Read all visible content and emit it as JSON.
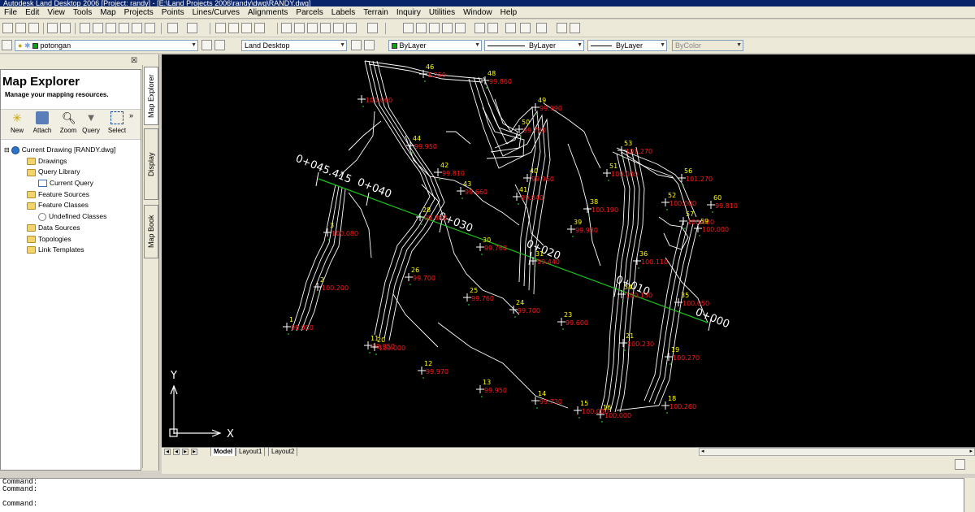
{
  "window": {
    "title": "Autodesk Land Desktop 2006 [Project: randy] - [E:\\Land Projects 2006\\randy\\dwg\\RANDY.dwg]"
  },
  "menu": [
    "File",
    "Edit",
    "View",
    "Tools",
    "Map",
    "Projects",
    "Points",
    "Lines/Curves",
    "Alignments",
    "Parcels",
    "Labels",
    "Terrain",
    "Inquiry",
    "Utilities",
    "Window",
    "Help"
  ],
  "layer_toolbar": {
    "layer_name": "potongan",
    "workspace": "Land Desktop",
    "color": "ByLayer",
    "linetype": "ByLayer",
    "lineweight": "ByLayer",
    "plotstyle": "ByColor"
  },
  "map_explorer": {
    "title": "Map Explorer",
    "subtitle": "Manage your mapping resources.",
    "tools": [
      "New",
      "Attach",
      "Zoom",
      "Query",
      "Select"
    ],
    "tree": [
      {
        "label": "Current Drawing [RANDY.dwg]",
        "level": 0,
        "icon": "globe-icon"
      },
      {
        "label": "Drawings",
        "level": 1,
        "icon": "folder-icon"
      },
      {
        "label": "Query Library",
        "level": 1,
        "icon": "folder-icon"
      },
      {
        "label": "Current Query",
        "level": 2,
        "icon": "query-icon"
      },
      {
        "label": "Feature Sources",
        "level": 1,
        "icon": "folder-icon"
      },
      {
        "label": "Feature Classes",
        "level": 1,
        "icon": "folder-icon"
      },
      {
        "label": "Undefined Classes",
        "level": 2,
        "icon": "question-icon"
      },
      {
        "label": "Data Sources",
        "level": 1,
        "icon": "folder-icon"
      },
      {
        "label": "Topologies",
        "level": 1,
        "icon": "folder-icon"
      },
      {
        "label": "Link Templates",
        "level": 1,
        "icon": "folder-icon"
      }
    ],
    "side_tabs": [
      "Map Explorer",
      "Display",
      "Map Book"
    ]
  },
  "drawing": {
    "ucs_x": "X",
    "ucs_y": "Y",
    "stations": [
      "0+045.415",
      "0+040",
      "0+030",
      "0+020",
      "0+010",
      "0+000"
    ],
    "points": [
      {
        "n": "46",
        "e": "1.250"
      },
      {
        "n": "48",
        "e": "99.860"
      },
      {
        "n": "49",
        "e": "99.990"
      },
      {
        "n": "",
        "e": "100.060"
      },
      {
        "n": "50",
        "e": "99.780"
      },
      {
        "n": "44",
        "e": "99.950"
      },
      {
        "n": "53",
        "e": "101.270"
      },
      {
        "n": "42",
        "e": "99.810"
      },
      {
        "n": "40",
        "e": "99.960"
      },
      {
        "n": "51",
        "e": "100.000"
      },
      {
        "n": "56",
        "e": "101.270"
      },
      {
        "n": "43",
        "e": "99.660"
      },
      {
        "n": "41",
        "e": "99.840"
      },
      {
        "n": "60",
        "e": "99.810"
      },
      {
        "n": "38",
        "e": "100.190"
      },
      {
        "n": "52",
        "e": "100.000"
      },
      {
        "n": "28",
        "e": "99.880"
      },
      {
        "n": "57",
        "e": "100.000"
      },
      {
        "n": "3",
        "e": "100.080"
      },
      {
        "n": "39",
        "e": "99.930"
      },
      {
        "n": "59",
        "e": "100.000"
      },
      {
        "n": "30",
        "e": "99.760"
      },
      {
        "n": "31",
        "e": "99.440"
      },
      {
        "n": "36",
        "e": "100.110"
      },
      {
        "n": "26",
        "e": "99.700"
      },
      {
        "n": "2",
        "e": "100.200"
      },
      {
        "n": "25",
        "e": "99.760"
      },
      {
        "n": "34",
        "e": "100.130"
      },
      {
        "n": "35",
        "e": "100.050"
      },
      {
        "n": "24",
        "e": "99.700"
      },
      {
        "n": "23",
        "e": "99.600"
      },
      {
        "n": "1",
        "e": "99.950"
      },
      {
        "n": "11",
        "e": "99.950"
      },
      {
        "n": "21",
        "e": "100.230"
      },
      {
        "n": "19",
        "e": "100.270"
      },
      {
        "n": "12",
        "e": "99.970"
      },
      {
        "n": "13",
        "e": "99.950"
      },
      {
        "n": "14",
        "e": "99.730"
      },
      {
        "n": "15",
        "e": "100.000"
      },
      {
        "n": "16",
        "e": "100.000"
      },
      {
        "n": "18",
        "e": "100.260"
      },
      {
        "n": "20",
        "e": "100.000"
      }
    ]
  },
  "layout_tabs": [
    "Model",
    "Layout1",
    "Layout2"
  ],
  "command_lines": [
    "Command:",
    "Command:",
    "",
    "Command:"
  ]
}
